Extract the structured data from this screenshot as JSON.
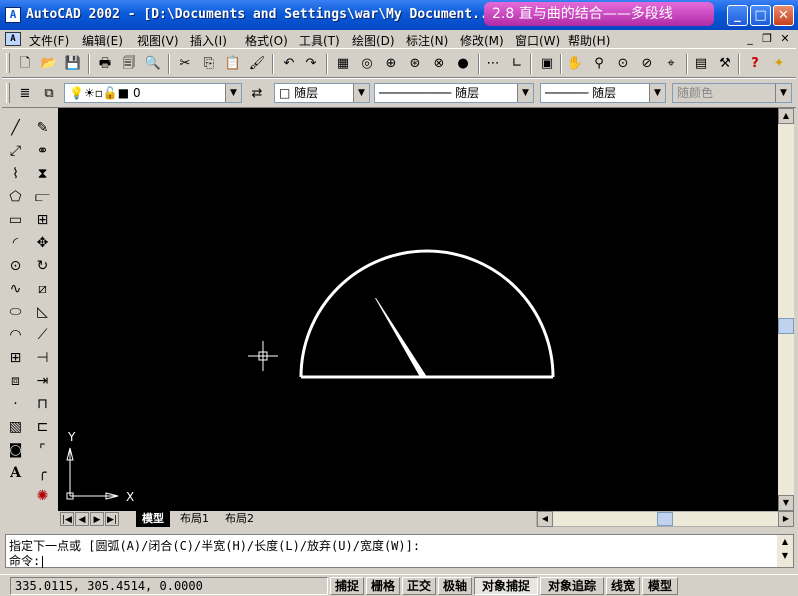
{
  "window": {
    "title": "AutoCAD 2002 - [D:\\Documents and Settings\\war\\My Document...",
    "caption_overlay": "2.8 直与曲的结合——多段线",
    "controls": [
      "_",
      "□",
      "✕"
    ]
  },
  "menu": {
    "items": [
      "文件(F)",
      "编辑(E)",
      "视图(V)",
      "插入(I)",
      "格式(O)",
      "工具(T)",
      "绘图(D)",
      "标注(N)",
      "修改(M)",
      "窗口(W)",
      "帮助(H)"
    ],
    "mdi_controls": [
      "_",
      "❐",
      "✕"
    ]
  },
  "properties_toolbar": {
    "layer_value": "0",
    "color_value": "随层",
    "linetype_value": "随层",
    "lineweight_value": "随层",
    "plotstyle_value": "随颜色"
  },
  "layout_tabs": {
    "nav": [
      "|◀",
      "◀",
      "▶",
      "▶|"
    ],
    "tabs": [
      "模型",
      "布局1",
      "布局2"
    ],
    "active": "模型"
  },
  "command": {
    "prompt_line": "指定下一点或 [圆弧(A)/闭合(C)/半宽(H)/长度(L)/放弃(U)/宽度(W)]:",
    "input_label": "命令:"
  },
  "status": {
    "coordinates": "335.0115, 305.4514, 0.0000",
    "toggles": [
      {
        "label": "捕捉",
        "on": false
      },
      {
        "label": "栅格",
        "on": false
      },
      {
        "label": "正交",
        "on": false
      },
      {
        "label": "极轴",
        "on": false
      },
      {
        "label": "对象捕捉",
        "on": true
      },
      {
        "label": "对象追踪",
        "on": false
      },
      {
        "label": "线宽",
        "on": false
      },
      {
        "label": "模型",
        "on": false
      }
    ]
  },
  "ucs": {
    "x_label": "X",
    "y_label": "Y"
  },
  "colors": {
    "titlebar": "#0a5bd9",
    "canvas": "#000000",
    "drawing": "#ffffff",
    "overlay": "#c03cb6"
  }
}
